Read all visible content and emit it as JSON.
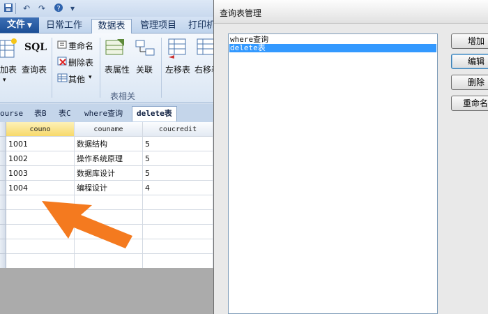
{
  "ribbon": {
    "file_label": "文件",
    "tabs": [
      "日常工作",
      "数据表",
      "管理项目",
      "打印机"
    ],
    "buttons": {
      "add_table": "加表",
      "query_table": "查询表",
      "sql": "SQL",
      "rename": "重命名",
      "delete_table": "删除表",
      "other": "其他",
      "table_props": "表属性",
      "relate": "关联",
      "move_left": "左移表",
      "move_right": "右移表"
    },
    "group_label": "表相关"
  },
  "object_tabs": [
    "ourse",
    "表B",
    "表C",
    "where查询",
    "delete表"
  ],
  "grid": {
    "columns": [
      "couno",
      "couname",
      "coucredit"
    ],
    "rows": [
      [
        "1001",
        "数据结构",
        "5"
      ],
      [
        "1002",
        "操作系统原理",
        "5"
      ],
      [
        "1003",
        "数据库设计",
        "5"
      ],
      [
        "1004",
        "编程设计",
        "4"
      ]
    ]
  },
  "dialog": {
    "title": "查询表管理",
    "items": [
      "where查询",
      "delete表"
    ],
    "selected_index": 1,
    "buttons": [
      "增加",
      "编辑",
      "删除",
      "重命名"
    ]
  },
  "colors": {
    "annotation_arrow": "#f47a1f",
    "selection": "#3399ff",
    "file_tab": "#2a5ea8"
  }
}
